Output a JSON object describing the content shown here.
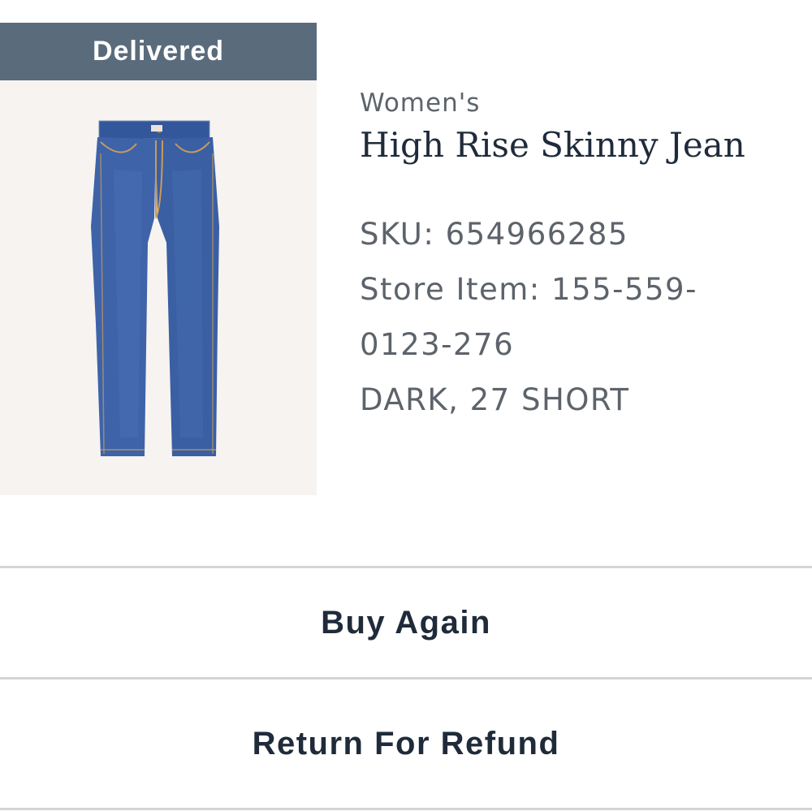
{
  "order_item": {
    "status": "Delivered",
    "image_label": "jeans-image",
    "category": "Women's",
    "name": "High Rise Skinny Jean",
    "sku": "SKU: 654966285",
    "store_item_line1": "Store Item: 155-559-",
    "store_item_line2": "0123-276",
    "variant": "DARK, 27 SHORT"
  },
  "actions": {
    "buy_again": "Buy Again",
    "return_for_refund": "Return For Refund"
  },
  "colors": {
    "status_banner": "#5a6b7c",
    "denim": "#3a5f9e",
    "text_primary": "#1f2b3a",
    "text_secondary": "#5d636b"
  }
}
